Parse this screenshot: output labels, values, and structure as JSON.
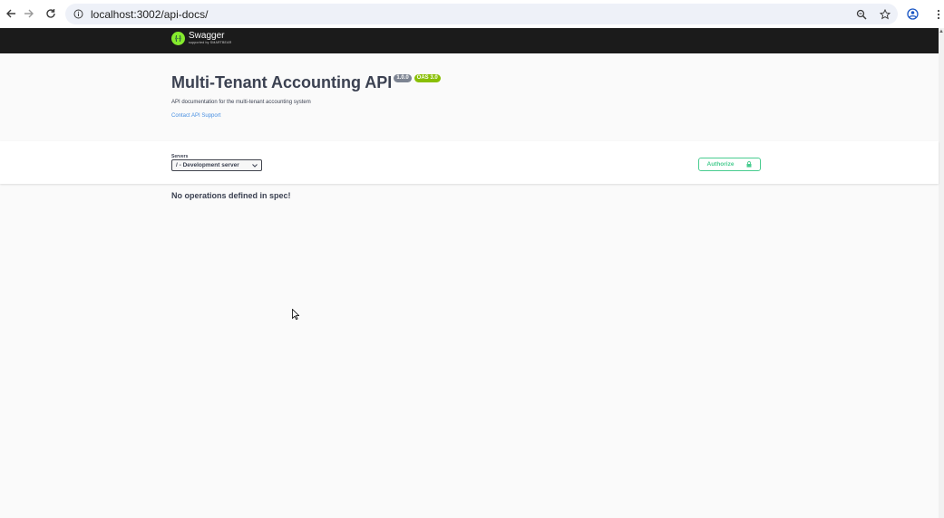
{
  "browser": {
    "url": "localhost:3002/api-docs/"
  },
  "swagger": {
    "logo_name": "Swagger",
    "logo_sub": "supported by SMARTBEAR",
    "brand_color": "#85ea2d"
  },
  "info": {
    "title": "Multi-Tenant Accounting API",
    "version_badge": "1.0.0",
    "oas_badge": "OAS 3.0",
    "description": "API documentation for the multi-tenant accounting system",
    "contact_link": "Contact API Support"
  },
  "servers": {
    "label": "Servers",
    "selected": "/ - Development server"
  },
  "authorize": {
    "label": "Authorize"
  },
  "operations": {
    "empty_message": "No operations defined in spec!"
  },
  "colors": {
    "accent_green": "#49cc90",
    "link_blue": "#4990e2",
    "text_dark": "#3b4151",
    "topbar": "#1b1b1b"
  },
  "icons": {
    "back": "arrow-left-icon",
    "forward": "arrow-right-icon",
    "reload": "reload-icon",
    "site_info": "info-icon",
    "zoom": "zoom-icon",
    "bookmark": "star-icon",
    "profile": "profile-icon",
    "menu": "kebab-menu-icon",
    "lock": "lock-icon",
    "chevron": "chevron-down-icon"
  }
}
